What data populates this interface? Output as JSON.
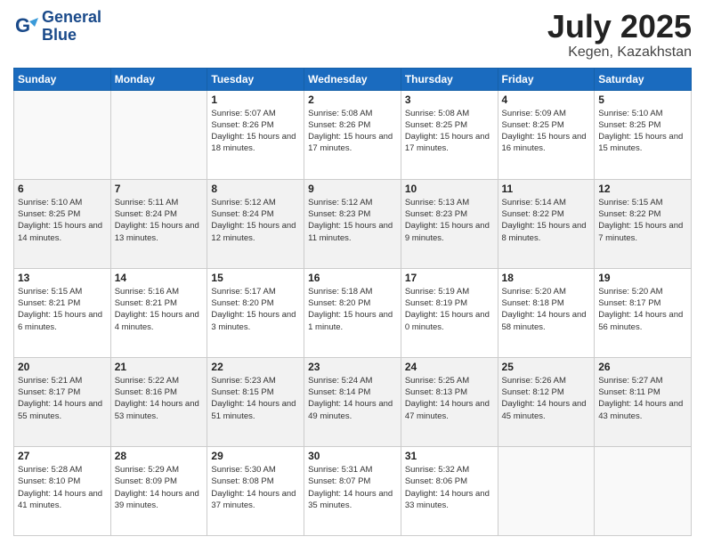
{
  "header": {
    "logo_line1": "General",
    "logo_line2": "Blue",
    "month": "July 2025",
    "location": "Kegen, Kazakhstan"
  },
  "weekdays": [
    "Sunday",
    "Monday",
    "Tuesday",
    "Wednesday",
    "Thursday",
    "Friday",
    "Saturday"
  ],
  "weeks": [
    [
      {
        "day": "",
        "sunrise": "",
        "sunset": "",
        "daylight": ""
      },
      {
        "day": "",
        "sunrise": "",
        "sunset": "",
        "daylight": ""
      },
      {
        "day": "1",
        "sunrise": "Sunrise: 5:07 AM",
        "sunset": "Sunset: 8:26 PM",
        "daylight": "Daylight: 15 hours and 18 minutes."
      },
      {
        "day": "2",
        "sunrise": "Sunrise: 5:08 AM",
        "sunset": "Sunset: 8:26 PM",
        "daylight": "Daylight: 15 hours and 17 minutes."
      },
      {
        "day": "3",
        "sunrise": "Sunrise: 5:08 AM",
        "sunset": "Sunset: 8:25 PM",
        "daylight": "Daylight: 15 hours and 17 minutes."
      },
      {
        "day": "4",
        "sunrise": "Sunrise: 5:09 AM",
        "sunset": "Sunset: 8:25 PM",
        "daylight": "Daylight: 15 hours and 16 minutes."
      },
      {
        "day": "5",
        "sunrise": "Sunrise: 5:10 AM",
        "sunset": "Sunset: 8:25 PM",
        "daylight": "Daylight: 15 hours and 15 minutes."
      }
    ],
    [
      {
        "day": "6",
        "sunrise": "Sunrise: 5:10 AM",
        "sunset": "Sunset: 8:25 PM",
        "daylight": "Daylight: 15 hours and 14 minutes."
      },
      {
        "day": "7",
        "sunrise": "Sunrise: 5:11 AM",
        "sunset": "Sunset: 8:24 PM",
        "daylight": "Daylight: 15 hours and 13 minutes."
      },
      {
        "day": "8",
        "sunrise": "Sunrise: 5:12 AM",
        "sunset": "Sunset: 8:24 PM",
        "daylight": "Daylight: 15 hours and 12 minutes."
      },
      {
        "day": "9",
        "sunrise": "Sunrise: 5:12 AM",
        "sunset": "Sunset: 8:23 PM",
        "daylight": "Daylight: 15 hours and 11 minutes."
      },
      {
        "day": "10",
        "sunrise": "Sunrise: 5:13 AM",
        "sunset": "Sunset: 8:23 PM",
        "daylight": "Daylight: 15 hours and 9 minutes."
      },
      {
        "day": "11",
        "sunrise": "Sunrise: 5:14 AM",
        "sunset": "Sunset: 8:22 PM",
        "daylight": "Daylight: 15 hours and 8 minutes."
      },
      {
        "day": "12",
        "sunrise": "Sunrise: 5:15 AM",
        "sunset": "Sunset: 8:22 PM",
        "daylight": "Daylight: 15 hours and 7 minutes."
      }
    ],
    [
      {
        "day": "13",
        "sunrise": "Sunrise: 5:15 AM",
        "sunset": "Sunset: 8:21 PM",
        "daylight": "Daylight: 15 hours and 6 minutes."
      },
      {
        "day": "14",
        "sunrise": "Sunrise: 5:16 AM",
        "sunset": "Sunset: 8:21 PM",
        "daylight": "Daylight: 15 hours and 4 minutes."
      },
      {
        "day": "15",
        "sunrise": "Sunrise: 5:17 AM",
        "sunset": "Sunset: 8:20 PM",
        "daylight": "Daylight: 15 hours and 3 minutes."
      },
      {
        "day": "16",
        "sunrise": "Sunrise: 5:18 AM",
        "sunset": "Sunset: 8:20 PM",
        "daylight": "Daylight: 15 hours and 1 minute."
      },
      {
        "day": "17",
        "sunrise": "Sunrise: 5:19 AM",
        "sunset": "Sunset: 8:19 PM",
        "daylight": "Daylight: 15 hours and 0 minutes."
      },
      {
        "day": "18",
        "sunrise": "Sunrise: 5:20 AM",
        "sunset": "Sunset: 8:18 PM",
        "daylight": "Daylight: 14 hours and 58 minutes."
      },
      {
        "day": "19",
        "sunrise": "Sunrise: 5:20 AM",
        "sunset": "Sunset: 8:17 PM",
        "daylight": "Daylight: 14 hours and 56 minutes."
      }
    ],
    [
      {
        "day": "20",
        "sunrise": "Sunrise: 5:21 AM",
        "sunset": "Sunset: 8:17 PM",
        "daylight": "Daylight: 14 hours and 55 minutes."
      },
      {
        "day": "21",
        "sunrise": "Sunrise: 5:22 AM",
        "sunset": "Sunset: 8:16 PM",
        "daylight": "Daylight: 14 hours and 53 minutes."
      },
      {
        "day": "22",
        "sunrise": "Sunrise: 5:23 AM",
        "sunset": "Sunset: 8:15 PM",
        "daylight": "Daylight: 14 hours and 51 minutes."
      },
      {
        "day": "23",
        "sunrise": "Sunrise: 5:24 AM",
        "sunset": "Sunset: 8:14 PM",
        "daylight": "Daylight: 14 hours and 49 minutes."
      },
      {
        "day": "24",
        "sunrise": "Sunrise: 5:25 AM",
        "sunset": "Sunset: 8:13 PM",
        "daylight": "Daylight: 14 hours and 47 minutes."
      },
      {
        "day": "25",
        "sunrise": "Sunrise: 5:26 AM",
        "sunset": "Sunset: 8:12 PM",
        "daylight": "Daylight: 14 hours and 45 minutes."
      },
      {
        "day": "26",
        "sunrise": "Sunrise: 5:27 AM",
        "sunset": "Sunset: 8:11 PM",
        "daylight": "Daylight: 14 hours and 43 minutes."
      }
    ],
    [
      {
        "day": "27",
        "sunrise": "Sunrise: 5:28 AM",
        "sunset": "Sunset: 8:10 PM",
        "daylight": "Daylight: 14 hours and 41 minutes."
      },
      {
        "day": "28",
        "sunrise": "Sunrise: 5:29 AM",
        "sunset": "Sunset: 8:09 PM",
        "daylight": "Daylight: 14 hours and 39 minutes."
      },
      {
        "day": "29",
        "sunrise": "Sunrise: 5:30 AM",
        "sunset": "Sunset: 8:08 PM",
        "daylight": "Daylight: 14 hours and 37 minutes."
      },
      {
        "day": "30",
        "sunrise": "Sunrise: 5:31 AM",
        "sunset": "Sunset: 8:07 PM",
        "daylight": "Daylight: 14 hours and 35 minutes."
      },
      {
        "day": "31",
        "sunrise": "Sunrise: 5:32 AM",
        "sunset": "Sunset: 8:06 PM",
        "daylight": "Daylight: 14 hours and 33 minutes."
      },
      {
        "day": "",
        "sunrise": "",
        "sunset": "",
        "daylight": ""
      },
      {
        "day": "",
        "sunrise": "",
        "sunset": "",
        "daylight": ""
      }
    ]
  ]
}
